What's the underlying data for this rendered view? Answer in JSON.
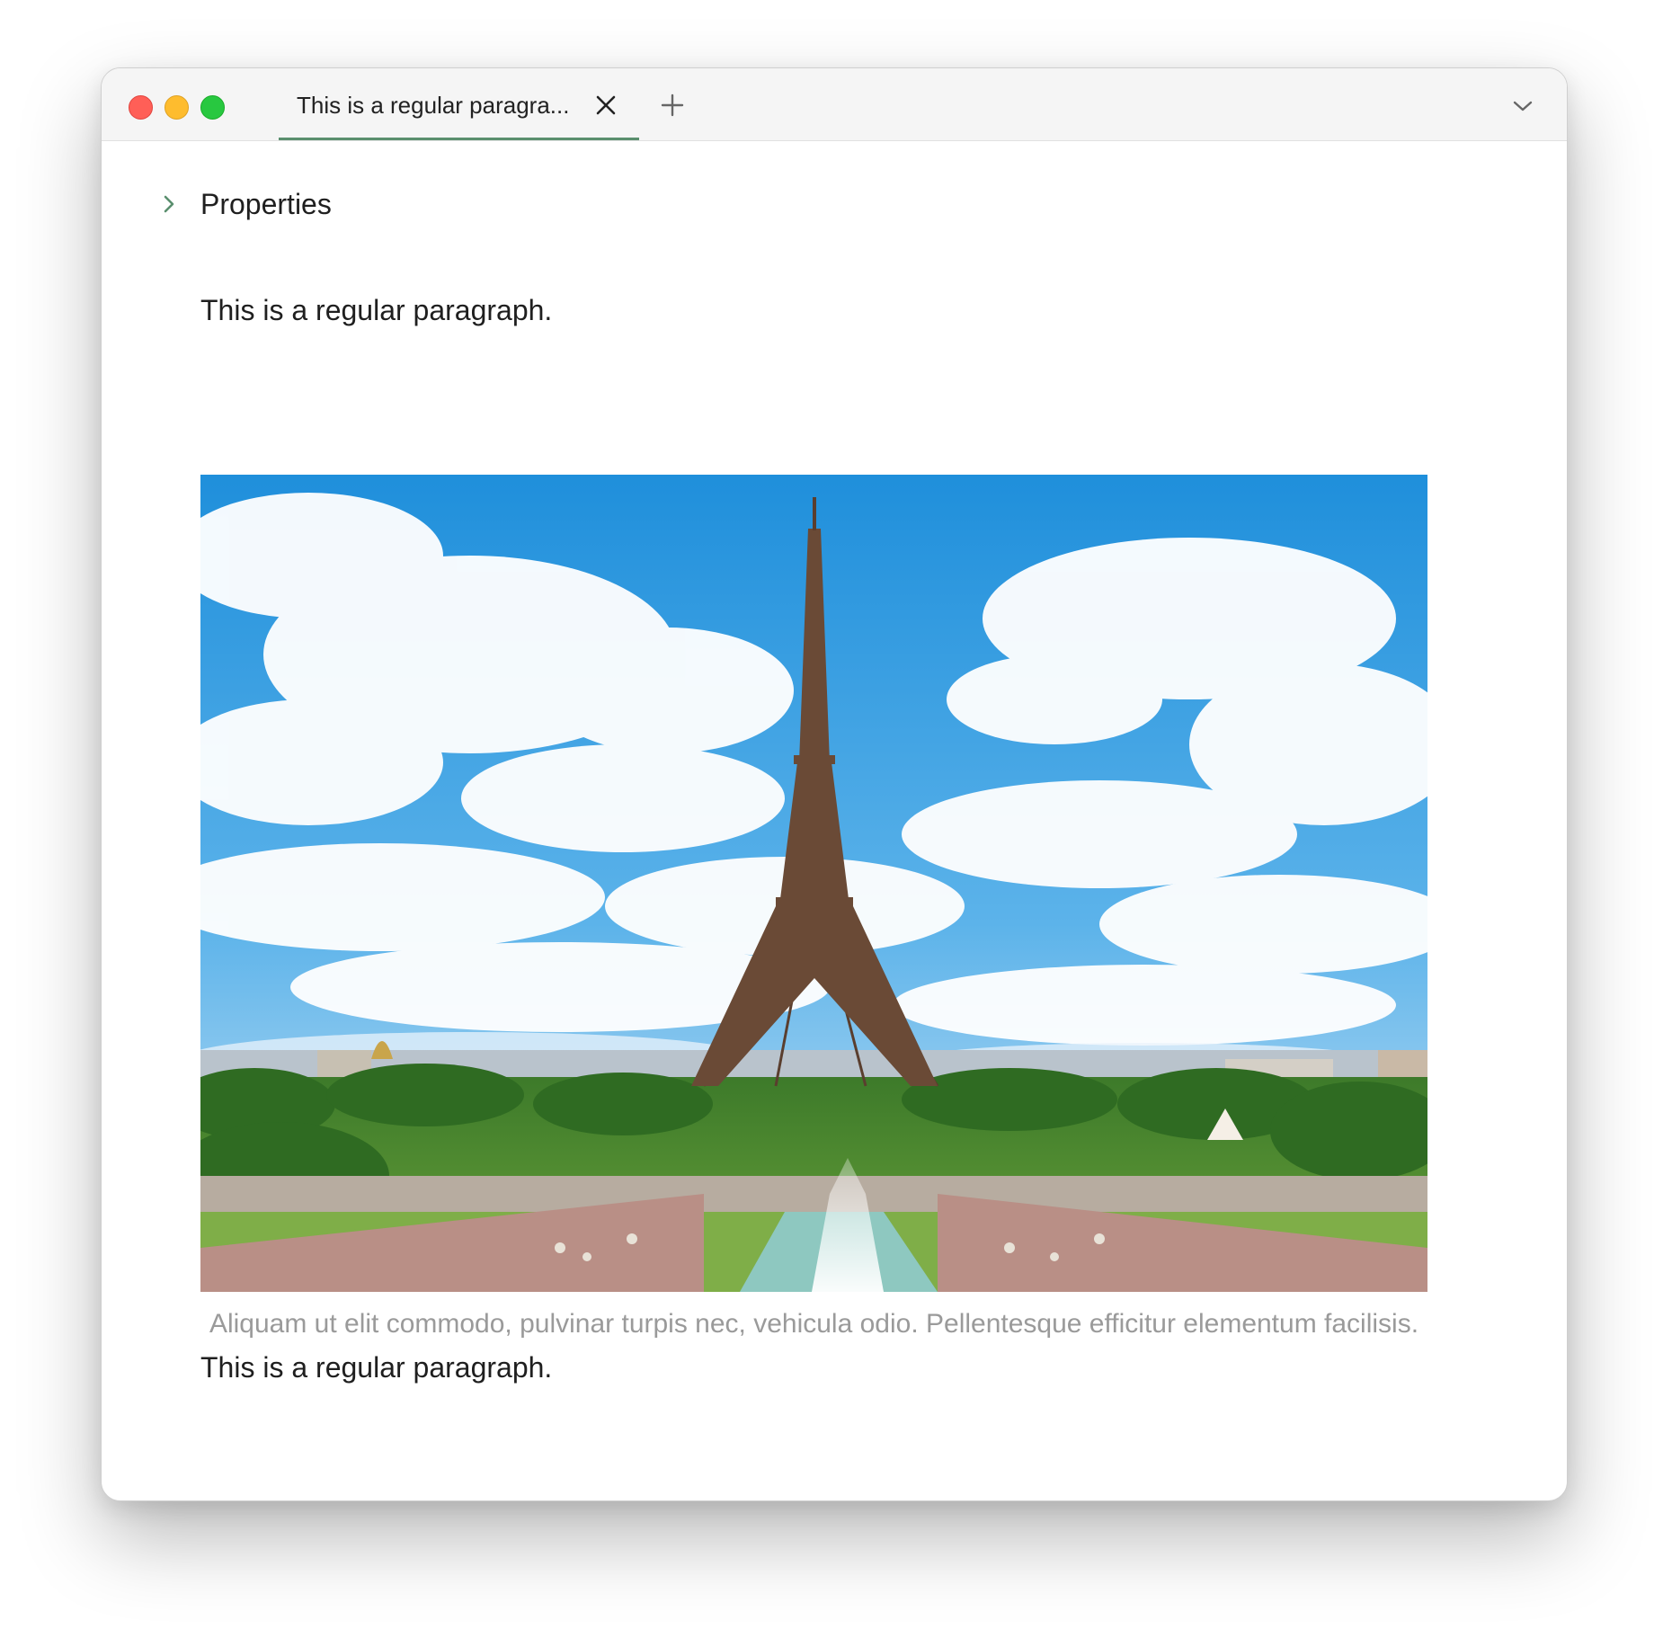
{
  "tab": {
    "title": "This is a regular paragra...",
    "active": true
  },
  "icons": {
    "close": "close-icon",
    "new_tab": "plus-icon",
    "tab_list": "chevron-down-icon",
    "properties_toggle": "chevron-right-icon"
  },
  "properties": {
    "label": "Properties"
  },
  "document": {
    "paragraph_1": "This is a regular paragraph.",
    "image_caption": "Aliquam ut elit commodo, pulvinar turpis nec, vehicula odio. Pellentesque efficitur elementum facilisis.",
    "paragraph_2": "This is a regular paragraph."
  },
  "colors": {
    "accent": "#5a8f6e",
    "close_button": "#ff5f57",
    "minimize_button": "#febc2e",
    "zoom_button": "#28c840",
    "caption_text": "#9a9a9a"
  }
}
